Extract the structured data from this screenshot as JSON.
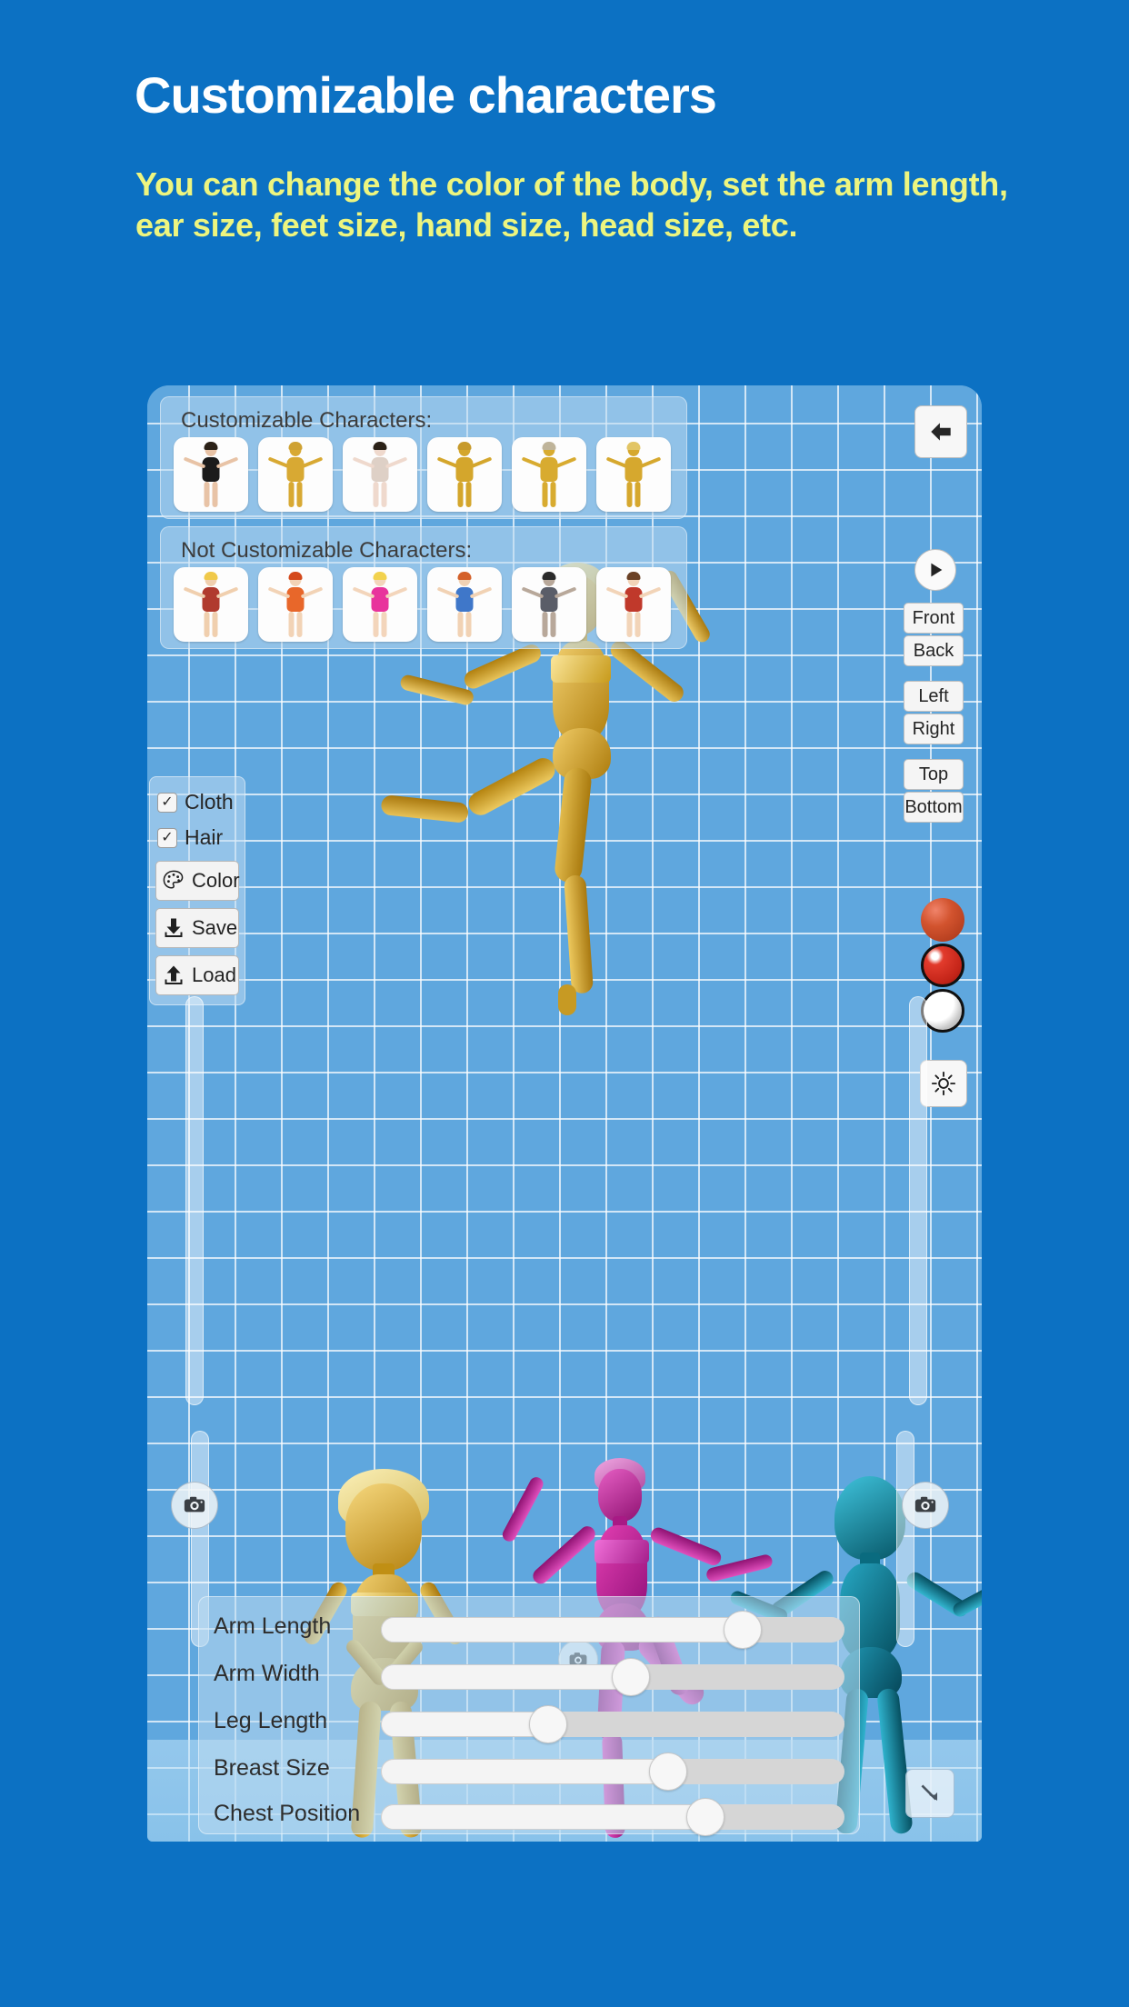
{
  "promo": {
    "title": "Customizable characters",
    "subtitle": "You can change the color of the body, set the arm length, ear size, feet size, hand size, head size, etc.",
    "title_color": "#ffffff",
    "subtitle_color": "#edf57f",
    "background_color": "#0c71c3"
  },
  "app": {
    "background_color": "#5fa7de",
    "grid_line_color": "#ffffff",
    "pickers": [
      {
        "label": "Customizable Characters:",
        "thumbs": [
          {
            "name": "male-black-outfit",
            "skin": "#e8c3a6",
            "outfit": "#1b1b1b",
            "hair": "#2b2117"
          },
          {
            "name": "male-gold",
            "skin": "#d8a933",
            "outfit": "#d8a933",
            "hair": "#cfa233"
          },
          {
            "name": "female-pale",
            "skin": "#efd9cd",
            "outfit": "#ded0c6",
            "hair": "#2b2117"
          },
          {
            "name": "female-gold",
            "skin": "#d4a62c",
            "outfit": "#d4a62c",
            "hair": "#c79a2b"
          },
          {
            "name": "child-gold",
            "skin": "#d8ab30",
            "outfit": "#d8ab30",
            "hair": "#bfb49a"
          },
          {
            "name": "female-gold-short",
            "skin": "#d6a82e",
            "outfit": "#d6a82e",
            "hair": "#e2c565"
          }
        ]
      },
      {
        "label": "Not Customizable Characters:",
        "thumbs": [
          {
            "name": "blond-boy-scarf",
            "skin": "#f0cfae",
            "outfit": "#b03a2e",
            "hair": "#f0c94a"
          },
          {
            "name": "orange-jumpsuit-girl",
            "skin": "#f2d3b6",
            "outfit": "#e8672a",
            "hair": "#d4491c"
          },
          {
            "name": "pink-top-blonde",
            "skin": "#f3d5bb",
            "outfit": "#e8339c",
            "hair": "#f2d24e"
          },
          {
            "name": "blue-shirt-boy",
            "skin": "#f1d2b4",
            "outfit": "#3f77c9",
            "hair": "#d4612a"
          },
          {
            "name": "armored-soldier",
            "skin": "#b8a89a",
            "outfit": "#5a5d68",
            "hair": "#2b2b2b"
          },
          {
            "name": "red-kimono-girl",
            "skin": "#f2d4b8",
            "outfit": "#c0392b",
            "hair": "#6b4226"
          }
        ]
      }
    ],
    "toolbox": {
      "checkboxes": [
        {
          "label": "Cloth",
          "checked": true,
          "mark": "✓"
        },
        {
          "label": "Hair",
          "checked": true,
          "mark": "✓"
        }
      ],
      "buttons": [
        {
          "label": "Color",
          "icon": "palette-icon"
        },
        {
          "label": "Save",
          "icon": "download-icon"
        },
        {
          "label": "Load",
          "icon": "upload-icon"
        }
      ]
    },
    "view_buttons": [
      "Front",
      "Back",
      "Left",
      "Right",
      "Top",
      "Bottom"
    ],
    "back_button_icon": "arrow-left-icon",
    "play_button_icon": "play-icon",
    "light_button_icon": "sun-icon",
    "camera_button_icon": "camera-icon",
    "resize_handle_icon": "arrow-diagonal-icon",
    "material_spheres": [
      {
        "name": "matte-orange-sphere",
        "color": "#c8472a"
      },
      {
        "name": "glossy-red-sphere",
        "color": "#d12e22"
      },
      {
        "name": "white-sphere",
        "color": "#ffffff"
      }
    ],
    "sliders": [
      {
        "label": "Arm Length",
        "value": 78
      },
      {
        "label": "Arm Width",
        "value": 54
      },
      {
        "label": "Leg Length",
        "value": 36
      },
      {
        "label": "Breast Size",
        "value": 62
      },
      {
        "label": "Chest Position",
        "value": 70
      }
    ],
    "stage_figures": [
      {
        "name": "gold-ballerina-main",
        "color": "#d4a017",
        "hair": "#e8d27a"
      },
      {
        "name": "gold-short-character",
        "color": "#d6a62a",
        "hair": "#f0e3a8"
      },
      {
        "name": "magenta-ballerina",
        "color": "#c2188f",
        "hair": "#e07ad0"
      },
      {
        "name": "teal-character",
        "color": "#0e7e96",
        "hair": "#0b6b80"
      }
    ]
  }
}
